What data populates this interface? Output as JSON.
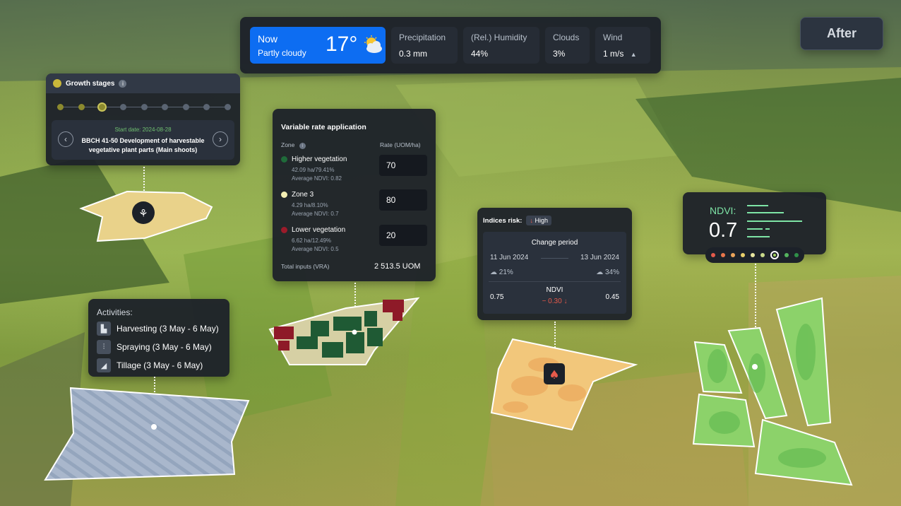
{
  "weather": {
    "now_label": "Now",
    "condition": "Partly cloudy",
    "temperature": "17°",
    "icon": "partly-cloudy-icon",
    "cells": [
      {
        "label": "Precipitation",
        "value": "0.3 mm"
      },
      {
        "label": "(Rel.) Humidity",
        "value": "44%"
      },
      {
        "label": "Clouds",
        "value": "3%"
      },
      {
        "label": "Wind",
        "value": "1 m/s"
      }
    ]
  },
  "after_button": "After",
  "growth": {
    "title": "Growth stages",
    "stages_total": 9,
    "current_stage": 3,
    "start_date": "Start date: 2024-08-28",
    "stage_description": "BBCH 41-50 Development of harvestable vegetative plant parts (Main shoots)"
  },
  "vra": {
    "title": "Variable rate application",
    "zone_header": "Zone",
    "rate_header": "Rate (UOM/ha)",
    "zones": [
      {
        "name": "Higher vegetation",
        "area": "42.09 ha/79.41%",
        "ndvi": "Average NDVI: 0.82",
        "rate": "70",
        "color": "#1f6b3a"
      },
      {
        "name": "Zone 3",
        "area": "4.29 ha/8.10%",
        "ndvi": "Average NDVI: 0.7",
        "rate": "80",
        "color": "#f4efb4"
      },
      {
        "name": "Lower vegetation",
        "area": "6.62 ha/12.49%",
        "ndvi": "Average NDVI: 0.5",
        "rate": "20",
        "color": "#9b1b2a"
      }
    ],
    "total_label": "Total inputs (VRA)",
    "total_value": "2 513.5 UOM"
  },
  "activities": {
    "title": "Activities:",
    "items": [
      {
        "label": "Harvesting (3 May - 6 May)",
        "icon": "harvester-icon"
      },
      {
        "label": "Spraying (3 May - 6 May)",
        "icon": "sprayer-icon"
      },
      {
        "label": "Tillage (3 May - 6 May)",
        "icon": "tillage-icon"
      }
    ]
  },
  "risk": {
    "title": "Indices risk:",
    "level": "High",
    "period_title": "Change period",
    "date_from": "11 Jun 2024",
    "date_to": "13 Jun 2024",
    "cloud_from": "21%",
    "cloud_to": "34%",
    "index_name": "NDVI",
    "value_from": "0.75",
    "value_to": "0.45",
    "delta": "− 0.30"
  },
  "ndvi": {
    "label": "NDVI:",
    "value": "0.7",
    "scale_colors": [
      "#e35a4b",
      "#e8764b",
      "#eba45a",
      "#e9cf6b",
      "#e7e5a0",
      "#c8d98a",
      "#9fcf5a",
      "#54b35e",
      "#2f8f48"
    ],
    "selected_index": 6
  },
  "colors": {
    "accent": "#0d6df2",
    "panel": "#1c2129",
    "ndvi_green": "#7ee4a6",
    "risk_red": "#e65a4b"
  }
}
